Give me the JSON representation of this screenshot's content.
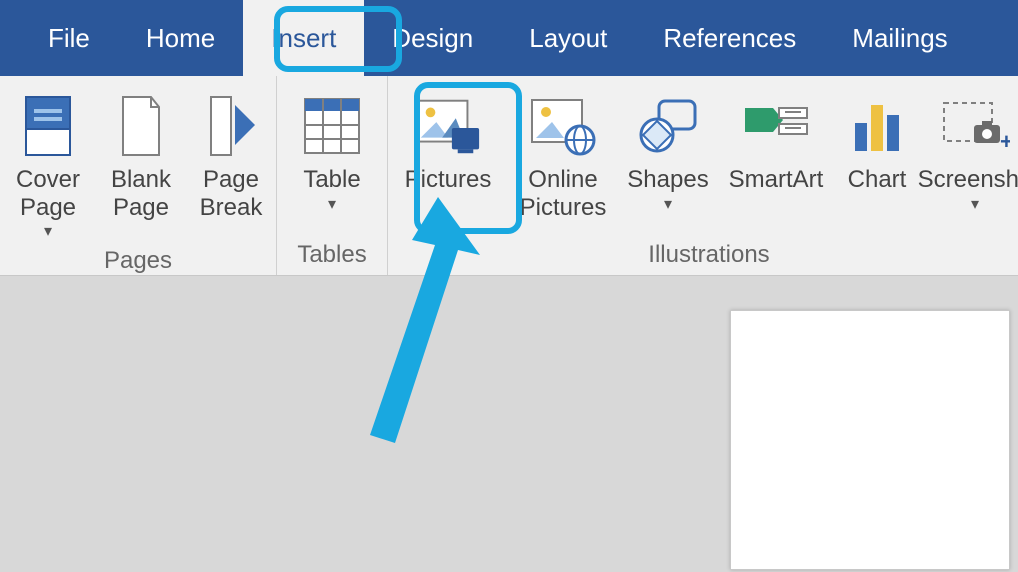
{
  "tabs": {
    "file": "File",
    "home": "Home",
    "insert": "Insert",
    "design": "Design",
    "layout": "Layout",
    "references": "References",
    "mailings": "Mailings"
  },
  "ribbon": {
    "pages": {
      "label": "Pages",
      "cover_page": "Cover\nPage",
      "blank_page": "Blank\nPage",
      "page_break": "Page\nBreak"
    },
    "tables": {
      "label": "Tables",
      "table": "Table"
    },
    "illustrations": {
      "label": "Illustrations",
      "pictures": "Pictures",
      "online_pictures": "Online\nPictures",
      "shapes": "Shapes",
      "smartart": "SmartArt",
      "chart": "Chart",
      "screenshot": "Screensho"
    }
  }
}
